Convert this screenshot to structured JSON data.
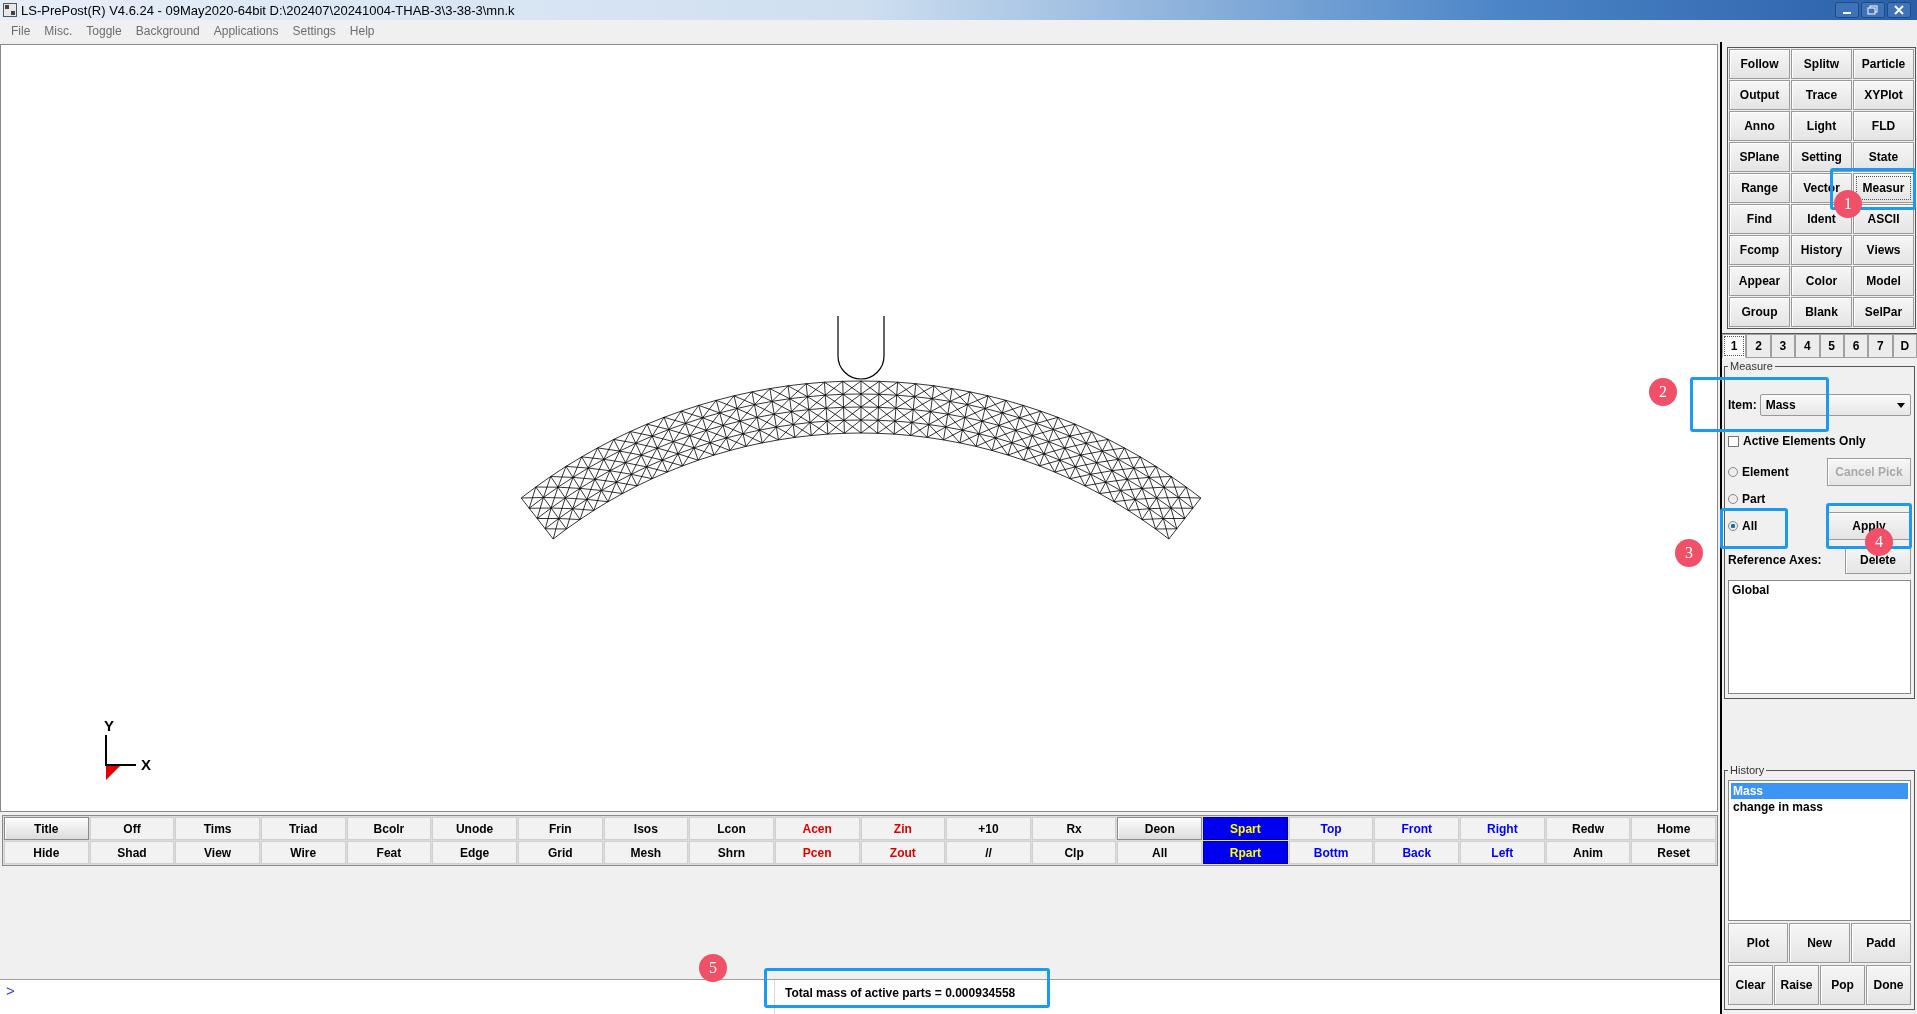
{
  "window": {
    "title": "LS-PrePost(R) V4.6.24 - 09May2020-64bit D:\\202407\\20241004-THAB-3\\3-38-3\\mn.k"
  },
  "menu": [
    "File",
    "Misc.",
    "Toggle",
    "Background",
    "Applications",
    "Settings",
    "Help"
  ],
  "viewport": {
    "triad": {
      "y_label": "Y",
      "x_label": "X"
    }
  },
  "command_grid": [
    {
      "label": "Follow",
      "focused": false
    },
    {
      "label": "Splitw",
      "focused": false
    },
    {
      "label": "Particle",
      "focused": false
    },
    {
      "label": "Output",
      "focused": false
    },
    {
      "label": "Trace",
      "focused": false
    },
    {
      "label": "XYPlot",
      "focused": false
    },
    {
      "label": "Anno",
      "focused": false
    },
    {
      "label": "Light",
      "focused": false
    },
    {
      "label": "FLD",
      "focused": false
    },
    {
      "label": "SPlane",
      "focused": false
    },
    {
      "label": "Setting",
      "focused": false
    },
    {
      "label": "State",
      "focused": false
    },
    {
      "label": "Range",
      "focused": false
    },
    {
      "label": "Vector",
      "focused": false
    },
    {
      "label": "Measur",
      "focused": true
    },
    {
      "label": "Find",
      "focused": false
    },
    {
      "label": "Ident",
      "focused": false
    },
    {
      "label": "ASCII",
      "focused": false
    },
    {
      "label": "Fcomp",
      "focused": false
    },
    {
      "label": "History",
      "focused": false
    },
    {
      "label": "Views",
      "focused": false
    },
    {
      "label": "Appear",
      "focused": false
    },
    {
      "label": "Color",
      "focused": false
    },
    {
      "label": "Model",
      "focused": false
    },
    {
      "label": "Group",
      "focused": false
    },
    {
      "label": "Blank",
      "focused": false
    },
    {
      "label": "SelPar",
      "focused": false
    }
  ],
  "page_tabs": [
    {
      "label": "1",
      "selected": true
    },
    {
      "label": "2",
      "selected": false
    },
    {
      "label": "3",
      "selected": false
    },
    {
      "label": "4",
      "selected": false
    },
    {
      "label": "5",
      "selected": false
    },
    {
      "label": "6",
      "selected": false
    },
    {
      "label": "7",
      "selected": false
    },
    {
      "label": "D",
      "selected": false
    }
  ],
  "measure": {
    "title": "Measure",
    "item_label": "Item:",
    "item_value": "Mass",
    "active_only": {
      "label": "Active Elements Only",
      "checked": false
    },
    "cancel_pick": {
      "label": "Cancel Pick",
      "disabled": true
    },
    "modes": [
      {
        "label": "Element",
        "selected": false
      },
      {
        "label": "Part",
        "selected": false
      },
      {
        "label": "All",
        "selected": true
      }
    ],
    "apply": "Apply",
    "reference_axes": "Reference Axes:",
    "delete": "Delete",
    "axes_list": [
      "Global"
    ]
  },
  "history": {
    "title": "History",
    "items": [
      {
        "label": "Mass",
        "selected": true
      },
      {
        "label": "change in mass",
        "selected": false
      }
    ],
    "buttons": [
      [
        "Plot",
        "New",
        "Padd"
      ],
      [
        "Clear",
        "Raise",
        "Pop",
        "Done"
      ]
    ]
  },
  "toolbar": {
    "rows": [
      [
        {
          "label": "Title",
          "color": "#000000",
          "selected": false,
          "raised": true
        },
        {
          "label": "Off",
          "color": "#000000",
          "selected": false,
          "raised": false
        },
        {
          "label": "Tims",
          "color": "#000000",
          "selected": false,
          "raised": false
        },
        {
          "label": "Triad",
          "color": "#000000",
          "selected": false,
          "raised": false
        },
        {
          "label": "Bcolr",
          "color": "#000000",
          "selected": false,
          "raised": false
        },
        {
          "label": "Unode",
          "color": "#000000",
          "selected": false,
          "raised": false
        },
        {
          "label": "Frin",
          "color": "#000000",
          "selected": false,
          "raised": false
        },
        {
          "label": "Isos",
          "color": "#000000",
          "selected": false,
          "raised": false
        },
        {
          "label": "Lcon",
          "color": "#000000",
          "selected": false,
          "raised": false
        },
        {
          "label": "Acen",
          "color": "#e00000",
          "selected": false,
          "raised": false
        },
        {
          "label": "Zin",
          "color": "#e00000",
          "selected": false,
          "raised": false
        },
        {
          "label": "+10",
          "color": "#000000",
          "selected": false,
          "raised": false
        },
        {
          "label": "Rx",
          "color": "#000000",
          "selected": false,
          "raised": false
        },
        {
          "label": "Deon",
          "color": "#000000",
          "selected": false,
          "raised": true
        },
        {
          "label": "Spart",
          "selected": true,
          "raised": false
        },
        {
          "label": "Top",
          "color": "#0000ff",
          "selected": false,
          "raised": false
        },
        {
          "label": "Front",
          "color": "#0000ff",
          "selected": false,
          "raised": false
        },
        {
          "label": "Right",
          "color": "#0000ff",
          "selected": false,
          "raised": false
        },
        {
          "label": "Redw",
          "color": "#000000",
          "selected": false,
          "raised": false
        },
        {
          "label": "Home",
          "color": "#000000",
          "selected": false,
          "raised": false
        }
      ],
      [
        {
          "label": "Hide",
          "color": "#000000",
          "selected": false,
          "raised": false
        },
        {
          "label": "Shad",
          "color": "#000000",
          "selected": false,
          "raised": false
        },
        {
          "label": "View",
          "color": "#000000",
          "selected": false,
          "raised": false
        },
        {
          "label": "Wire",
          "color": "#000000",
          "selected": false,
          "raised": false
        },
        {
          "label": "Feat",
          "color": "#000000",
          "selected": false,
          "raised": false
        },
        {
          "label": "Edge",
          "color": "#000000",
          "selected": false,
          "raised": false
        },
        {
          "label": "Grid",
          "color": "#000000",
          "selected": false,
          "raised": false
        },
        {
          "label": "Mesh",
          "color": "#000000",
          "selected": false,
          "raised": false
        },
        {
          "label": "Shrn",
          "color": "#000000",
          "selected": false,
          "raised": false
        },
        {
          "label": "Pcen",
          "color": "#e00000",
          "selected": false,
          "raised": false
        },
        {
          "label": "Zout",
          "color": "#e00000",
          "selected": false,
          "raised": false
        },
        {
          "label": "//",
          "color": "#000000",
          "selected": false,
          "raised": false
        },
        {
          "label": "Clp",
          "color": "#000000",
          "selected": false,
          "raised": false
        },
        {
          "label": "All",
          "color": "#000000",
          "selected": false,
          "raised": false
        },
        {
          "label": "Rpart",
          "selected": true,
          "raised": false
        },
        {
          "label": "Bottm",
          "color": "#0000ff",
          "selected": false,
          "raised": false
        },
        {
          "label": "Back",
          "color": "#0000ff",
          "selected": false,
          "raised": false
        },
        {
          "label": "Left",
          "color": "#0000ff",
          "selected": false,
          "raised": false
        },
        {
          "label": "Anim",
          "color": "#000000",
          "selected": false,
          "raised": false
        },
        {
          "label": "Reset",
          "color": "#000000",
          "selected": false,
          "raised": false
        }
      ]
    ]
  },
  "command_line": {
    "prompt": ">",
    "output": "Total mass of active parts = 0.000934558"
  },
  "annotations": [
    {
      "label": "1"
    },
    {
      "label": "2"
    },
    {
      "label": "3"
    },
    {
      "label": "4"
    },
    {
      "label": "5"
    }
  ]
}
